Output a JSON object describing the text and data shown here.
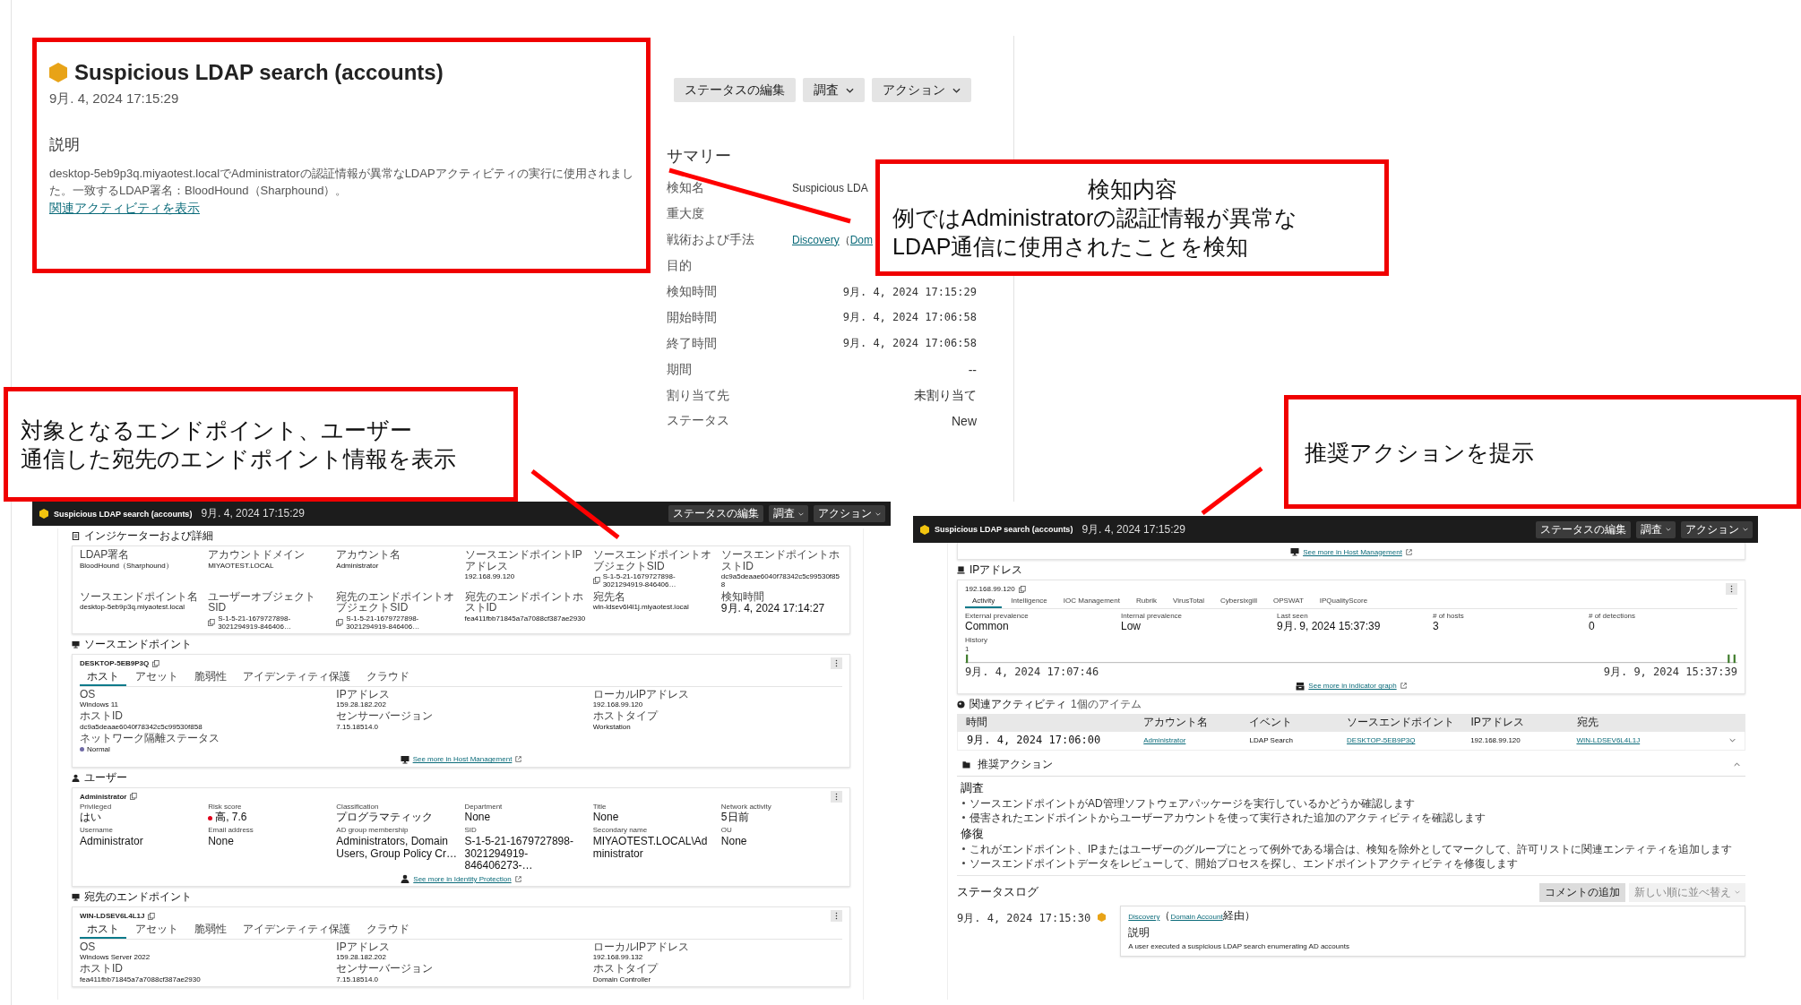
{
  "alert": {
    "title": "Suspicious LDAP search (accounts)",
    "time": "9月. 4, 2024 17:15:29",
    "description_heading": "説明",
    "description": "desktop-5eb9p3q.miyaotest.localでAdministratorの認証情報が異常なLDAPアクティビティの実行に使用されました。一致するLDAP署名：BloodHound（Sharphound）。",
    "link": "関連アクティビティを表示"
  },
  "actions": [
    {
      "label": "ステータスの編集",
      "dropdown": false
    },
    {
      "label": "調査",
      "dropdown": true
    },
    {
      "label": "アクション",
      "dropdown": true
    }
  ],
  "summary": {
    "title": "サマリー",
    "rows": [
      {
        "label": "検知名",
        "kind": "title",
        "value": "Suspicious LDA"
      },
      {
        "label": "重大度",
        "kind": "empty"
      },
      {
        "label": "戦術および手法",
        "kind": "links",
        "parts": [
          {
            "text": "Discovery",
            "link": true
          },
          {
            "text": "（",
            "link": false
          },
          {
            "text": "Dom",
            "link": true
          }
        ]
      },
      {
        "label": "目的",
        "kind": "empty"
      },
      {
        "label": "検知時間",
        "kind": "mono",
        "value": "9月. 4, 2024 17:15:29"
      },
      {
        "label": "開始時間",
        "kind": "mono",
        "value": "9月. 4, 2024 17:06:58"
      },
      {
        "label": "終了時間",
        "kind": "mono",
        "value": "9月. 4, 2024 17:06:58"
      },
      {
        "label": "期間",
        "kind": "text",
        "value": "--"
      },
      {
        "label": "割り当て先",
        "kind": "text",
        "value": "未割り当て"
      },
      {
        "label": "ステータス",
        "kind": "text",
        "value": "New"
      }
    ]
  },
  "annotations": [
    {
      "heading": "検知内容",
      "lines": [
        "例ではAdministratorの認証情報が異常な",
        "LDAP通信に使用されたことを検知"
      ]
    },
    {
      "lines": [
        "対象となるエンドポイント、ユーザー",
        "通信した宛先のエンドポイント情報を表示"
      ]
    },
    {
      "lines": [
        "推奨アクションを提示"
      ]
    }
  ],
  "left_screen": {
    "header": {
      "title": "Suspicious LDAP search (accounts)",
      "time": "9月. 4, 2024 17:15:29",
      "buttons": [
        {
          "label": "ステータスの編集",
          "dropdown": false
        },
        {
          "label": "調査",
          "dropdown": true
        },
        {
          "label": "アクション",
          "dropdown": true
        }
      ]
    },
    "indicators": {
      "title": "インジケーターおよび詳細",
      "fields": [
        {
          "label": "LDAP署名",
          "value": "BloodHound（Sharphound）"
        },
        {
          "label": "アカウントドメイン",
          "value": "MIYAOTEST.LOCAL"
        },
        {
          "label": "アカウント名",
          "value": "Administrator"
        },
        {
          "label": "ソースエンドポイントIPアドレス",
          "value": "192.168.99.120"
        },
        {
          "label": "ソースエンドポイントオブジェクトSID",
          "value": "S-1-5-21-1679727898-3021294919-846406…",
          "copy": true
        },
        {
          "label": "ソースエンドポイントホストID",
          "value": "dc9a5deaae6040f78342c5c99530f858"
        },
        {
          "label": "ソースエンドポイント名",
          "value": "desktop-5eb9p3q.miyaotest.local"
        },
        {
          "label": "ユーザーオブジェクトSID",
          "value": "S-1-5-21-1679727898-3021294919-846406…",
          "copy": true
        },
        {
          "label": "宛先のエンドポイントオブジェクトSID",
          "value": "S-1-5-21-1679727898-3021294919-846406…",
          "copy": true
        },
        {
          "label": "宛先のエンドポイントホストID",
          "value": "fea411fbb71845a7a7088cf387ae2930"
        },
        {
          "label": "宛先名",
          "value": "win-ldsev6l4l1j.miyaotest.local"
        },
        {
          "label": "検知時間",
          "value": "9月. 4, 2024 17:14:27"
        }
      ]
    },
    "source_endpoint": {
      "title": "ソースエンドポイント",
      "name": "DESKTOP-5EB9P3Q",
      "tabs": [
        {
          "label": "ホスト",
          "selected": true
        },
        {
          "label": "アセット",
          "selected": false
        },
        {
          "label": "脆弱性",
          "selected": false
        },
        {
          "label": "アイデンティティ保護",
          "selected": false
        },
        {
          "label": "クラウド",
          "selected": false
        }
      ],
      "fields": [
        {
          "label": "OS",
          "value": "Windows 11"
        },
        {
          "label": "IPアドレス",
          "value": "159.28.182.202"
        },
        {
          "label": "ローカルIPアドレス",
          "value": "192.168.99.120"
        },
        {
          "label": "ホストID",
          "value": "dc9a5deaae6040f78342c5c99530f858"
        },
        {
          "label": "センサーバージョン",
          "value": "7.15.18514.0"
        },
        {
          "label": "ホストタイプ",
          "value": "Workstation"
        },
        {
          "label": "ネットワーク隔離ステータス",
          "value": "Normal",
          "color": "#6f6aa5"
        }
      ],
      "link": "See more in Host Management"
    },
    "user": {
      "title": "ユーザー",
      "name": "Administrator",
      "fields": [
        {
          "label": "Privileged",
          "value": "はい"
        },
        {
          "label": "Risk score",
          "value": "高, 7.6",
          "color": "#e0001b"
        },
        {
          "label": "Classification",
          "value": "プログラマティック"
        },
        {
          "label": "Department",
          "value": "None"
        },
        {
          "label": "Title",
          "value": "None"
        },
        {
          "label": "Network activity",
          "value": "5日前"
        },
        {
          "label": "Username",
          "value": "Administrator"
        },
        {
          "label": "Email address",
          "value": "None"
        },
        {
          "label": "AD group membership",
          "value": "Administrators, Domain Users, Group Policy Cr…"
        },
        {
          "label": "SID",
          "value": "S-1-5-21-1679727898-3021294919-846406273-…"
        },
        {
          "label": "Secondary name",
          "value": "MIYAOTEST.LOCAL\\Administrator"
        },
        {
          "label": "OU",
          "value": "None"
        }
      ],
      "link": "See more in Identity Protection"
    },
    "destination_endpoint": {
      "title": "宛先のエンドポイント",
      "name": "WIN-LDSEV6L4L1J",
      "tabs": [
        {
          "label": "ホスト",
          "selected": true
        },
        {
          "label": "アセット",
          "selected": false
        },
        {
          "label": "脆弱性",
          "selected": false
        },
        {
          "label": "アイデンティティ保護",
          "selected": false
        },
        {
          "label": "クラウド",
          "selected": false
        }
      ],
      "fields": [
        {
          "label": "OS",
          "value": "Windows Server 2022"
        },
        {
          "label": "IPアドレス",
          "value": "159.28.182.202"
        },
        {
          "label": "ローカルIPアドレス",
          "value": "192.168.99.132"
        },
        {
          "label": "ホストID",
          "value": "fea411fbb71845a7a7088cf387ae2930"
        },
        {
          "label": "センサーバージョン",
          "value": "7.15.18514.0"
        },
        {
          "label": "ホストタイプ",
          "value": "Domain Controller"
        }
      ]
    }
  },
  "right_screen": {
    "header": {
      "title": "Suspicious LDAP search (accounts)",
      "time": "9月. 4, 2024 17:15:29",
      "buttons": [
        {
          "label": "ステータスの編集",
          "dropdown": false
        },
        {
          "label": "調査",
          "dropdown": true
        },
        {
          "label": "アクション",
          "dropdown": true
        }
      ]
    },
    "host_link": "See more in Host Management",
    "ip": {
      "title": "IPアドレス",
      "address": "192.168.99.120",
      "tabs": [
        {
          "label": "Activity",
          "selected": true
        },
        {
          "label": "Intelligence",
          "selected": false
        },
        {
          "label": "IOC Management",
          "selected": false
        },
        {
          "label": "Rubrik",
          "selected": false
        },
        {
          "label": "VirusTotal",
          "selected": false
        },
        {
          "label": "Cybersixgill",
          "selected": false
        },
        {
          "label": "OPSWAT",
          "selected": false
        },
        {
          "label": "IPQualityScore",
          "selected": false
        }
      ],
      "fields": [
        {
          "label": "External prevalence",
          "value": "Common"
        },
        {
          "label": "Internal prevalence",
          "value": "Low"
        },
        {
          "label": "Last seen",
          "value": "9月. 9, 2024 15:37:39"
        },
        {
          "label": "# of hosts",
          "value": "3"
        },
        {
          "label": "# of detections",
          "value": "0"
        }
      ],
      "history_label": "History",
      "history_tick": "1",
      "history_start": "9月. 4, 2024 17:07:46",
      "history_end": "9月. 9, 2024 15:37:39",
      "link": "See more in indicator graph"
    },
    "activity": {
      "title": "関連アクティビティ",
      "count": "1個のアイテム",
      "columns": [
        "時間",
        "アカウント名",
        "イベント",
        "ソースエンドポイント",
        "IPアドレス",
        "宛先"
      ],
      "rows": [
        {
          "expanded": false,
          "cells": [
            {
              "text": "9月. 4, 2024 17:06:00",
              "kind": "mono"
            },
            {
              "text": "Administrator",
              "kind": "link"
            },
            {
              "text": "LDAP Search",
              "kind": "text"
            },
            {
              "text": "DESKTOP-5EB9P3Q",
              "kind": "link"
            },
            {
              "text": "192.168.99.120",
              "kind": "text"
            },
            {
              "text": "WIN-LDSEV6L4L1J",
              "kind": "link"
            }
          ]
        }
      ]
    },
    "recommended": {
      "title": "推奨アクション",
      "expanded": true,
      "groups": [
        {
          "heading": "調査",
          "items": [
            "ソースエンドポイントがAD管理ソフトウェアパッケージを実行しているかどうか確認します",
            "侵害されたエンドポイントからユーザーアカウントを使って実行された追加のアクティビティを確認します"
          ]
        },
        {
          "heading": "修復",
          "items": [
            "これがエンドポイント、IPまたはユーザーのグループにとって例外である場合は、検知を除外としてマークして、許可リストに関連エンティティを追加します",
            "ソースエンドポイントデータをレビューして、開始プロセスを探し、エンドポイントアクティビティを修復します"
          ]
        }
      ]
    },
    "status_log": {
      "title": "ステータスログ",
      "buttons": [
        {
          "label": "コメントの追加",
          "disabled": false,
          "dropdown": false
        },
        {
          "label": "新しい順に並べ替え",
          "disabled": true,
          "dropdown": true
        }
      ],
      "entries": [
        {
          "time": "9月. 4, 2024 17:15:30",
          "parts": [
            {
              "text": "Discovery",
              "link": true
            },
            {
              "text": "（",
              "link": false
            },
            {
              "text": "Domain Account",
              "link": true
            },
            {
              "text": "経由）",
              "link": false
            }
          ],
          "heading": "説明",
          "text": "A user executed a suspicious LDAP search enumerating AD accounts"
        }
      ]
    }
  }
}
